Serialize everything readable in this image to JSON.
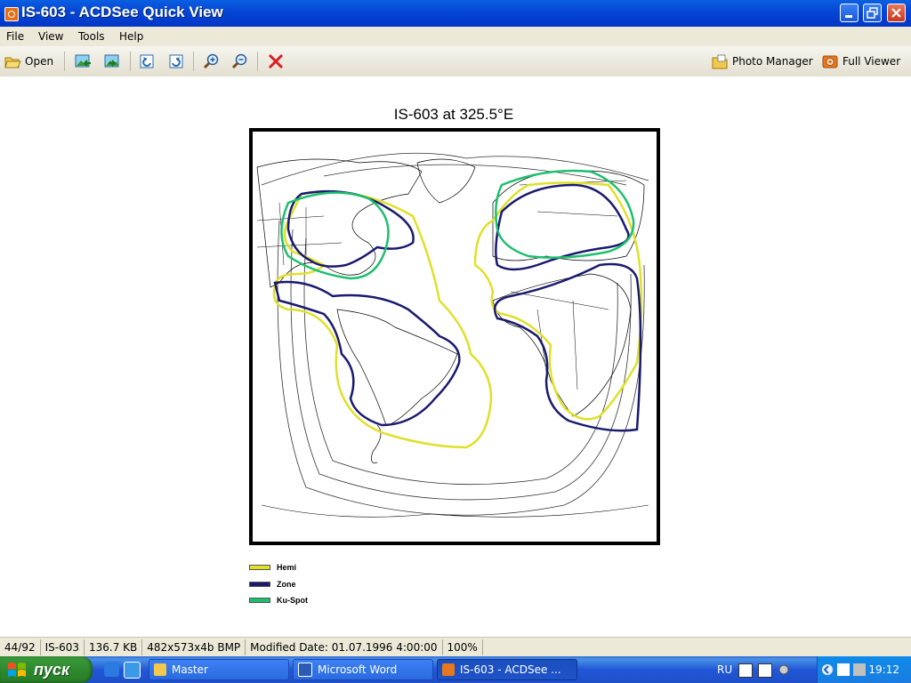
{
  "window": {
    "title": "IS-603 - ACDSee Quick View"
  },
  "menu": [
    "File",
    "View",
    "Tools",
    "Help"
  ],
  "toolbar": {
    "open_label": "Open",
    "photo_manager_label": "Photo Manager",
    "full_viewer_label": "Full Viewer"
  },
  "image": {
    "title": "IS-603 at 325.5°E",
    "legend": [
      {
        "label": "Hemi",
        "color": "#e0e02a"
      },
      {
        "label": "Zone",
        "color": "#1a1a6e"
      },
      {
        "label": "Ku-Spot",
        "color": "#1fbf6f"
      }
    ]
  },
  "status": {
    "index": "44/92",
    "name": "IS-603",
    "size": "136.7 KB",
    "dimensions": "482x573x4b BMP",
    "modified": "Modified Date: 01.07.1996 4:00:00",
    "zoom": "100%"
  },
  "taskbar": {
    "start_label": "пуск",
    "tasks": [
      "Master",
      "Microsoft Word",
      "IS-603 - ACDSee ..."
    ],
    "lang": "RU",
    "clock": "19:12"
  },
  "colors": {
    "hemi": "#e0e02a",
    "zone": "#1a1a6e",
    "kuspot": "#1fbf6f"
  }
}
